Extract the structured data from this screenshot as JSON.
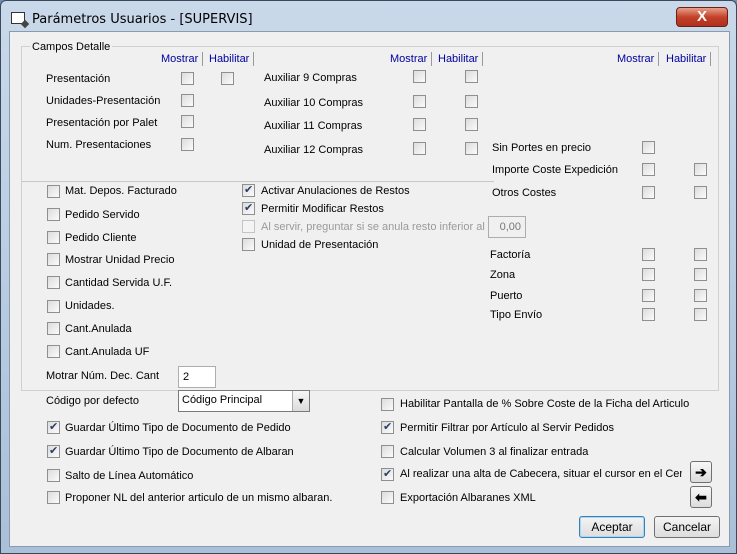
{
  "window": {
    "title": "Parámetros Usuarios - [SUPERVIS]",
    "close_glyph": "X"
  },
  "group": {
    "label": "Campos Detalle",
    "headers": {
      "mostrar": "Mostrar",
      "habilitar": "Habilitar"
    }
  },
  "fields_col1": [
    {
      "label": "Presentación",
      "mostrar": false,
      "habilitar": false
    },
    {
      "label": "Unidades-Presentación",
      "mostrar": false
    },
    {
      "label": "Presentación por Palet",
      "mostrar": false
    },
    {
      "label": "Num. Presentaciones",
      "mostrar": false
    }
  ],
  "fields_col2": [
    {
      "label": "Auxiliar 9 Compras",
      "mostrar": false,
      "habilitar": false
    },
    {
      "label": "Auxiliar 10 Compras",
      "mostrar": false,
      "habilitar": false
    },
    {
      "label": "Auxiliar 11 Compras",
      "mostrar": false,
      "habilitar": false
    },
    {
      "label": "Auxiliar 12 Compras",
      "mostrar": false,
      "habilitar": false
    }
  ],
  "fields_col3": [
    {
      "label": "Sin Portes en precio",
      "mostrar": false
    },
    {
      "label": "Importe Coste Expedición",
      "mostrar": false,
      "habilitar": false
    },
    {
      "label": "Otros Costes",
      "mostrar": false,
      "habilitar": false
    },
    {
      "label": "Factoría",
      "mostrar": false,
      "habilitar": false
    },
    {
      "label": "Zona",
      "mostrar": false,
      "habilitar": false
    },
    {
      "label": "Puerto",
      "mostrar": false,
      "habilitar": false
    },
    {
      "label": "Tipo Envío",
      "mostrar": false,
      "habilitar": false
    }
  ],
  "checks_left": [
    {
      "label": "Mat. Depos. Facturado",
      "checked": false
    },
    {
      "label": "Pedido Servido",
      "checked": false
    },
    {
      "label": "Pedido Cliente",
      "checked": false
    },
    {
      "label": "Mostrar Unidad Precio",
      "checked": false
    },
    {
      "label": "Cantidad Servida U.F.",
      "checked": false
    },
    {
      "label": "Unidades.",
      "checked": false
    },
    {
      "label": "Cant.Anulada",
      "checked": false
    },
    {
      "label": "Cant.Anulada UF",
      "checked": false
    }
  ],
  "checks_mid": [
    {
      "label": "Activar Anulaciones de Restos",
      "checked": true
    },
    {
      "label": "Permitir Modificar Restos",
      "checked": true
    },
    {
      "label": "Al servir, preguntar si se anula resto inferior al %",
      "checked": false,
      "disabled": true
    },
    {
      "label": "Unidad de Presentación",
      "checked": false
    }
  ],
  "resto_percent": "0,00",
  "dec_cant": {
    "label": "Motrar Núm. Dec. Cant",
    "value": "2"
  },
  "codigo": {
    "label": "Código por defecto",
    "value": "Código Principal"
  },
  "bottom_left": [
    {
      "label": "Guardar Último Tipo de Documento de Pedido",
      "checked": true
    },
    {
      "label": "Guardar Último Tipo de Documento de Albaran",
      "checked": true
    },
    {
      "label": "Salto de Línea Automático",
      "checked": false
    },
    {
      "label": "Proponer NL del anterior articulo de un mismo albaran.",
      "checked": false
    }
  ],
  "bottom_right": [
    {
      "label": "Habilitar Pantalla de % Sobre Coste de la Ficha del Articulo",
      "checked": false
    },
    {
      "label": "Permitir Filtrar por Artículo al Servir Pedidos",
      "checked": true
    },
    {
      "label": "Calcular Volumen 3 al finalizar entrada",
      "checked": false
    },
    {
      "label": "Al realizar una alta de Cabecera, situar el cursor en el Centro",
      "checked": true
    },
    {
      "label": "Exportación Albaranes XML",
      "checked": false
    }
  ],
  "nav": {
    "next_glyph": "➔",
    "prev_glyph": "⬅"
  },
  "buttons": {
    "accept": "Aceptar",
    "cancel": "Cancelar"
  }
}
